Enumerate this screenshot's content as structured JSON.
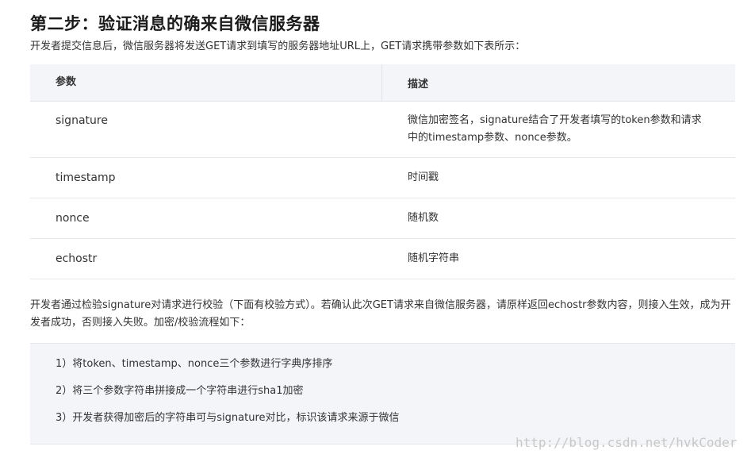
{
  "heading": "第二步：验证消息的确来自微信服务器",
  "intro": "开发者提交信息后，微信服务器将发送GET请求到填写的服务器地址URL上，GET请求携带参数如下表所示：",
  "table": {
    "headers": [
      "参数",
      "描述"
    ],
    "rows": [
      {
        "param": "signature",
        "desc": "微信加密签名，signature结合了开发者填写的token参数和请求中的timestamp参数、nonce参数。"
      },
      {
        "param": "timestamp",
        "desc": "时间戳"
      },
      {
        "param": "nonce",
        "desc": "随机数"
      },
      {
        "param": "echostr",
        "desc": "随机字符串"
      }
    ]
  },
  "paragraph": "开发者通过检验signature对请求进行校验（下面有校验方式）。若确认此次GET请求来自微信服务器，请原样返回echostr参数内容，则接入生效，成为开发者成功，否则接入失败。加密/校验流程如下：",
  "steps": [
    "1）将token、timestamp、nonce三个参数进行字典序排序",
    "2）将三个参数字符串拼接成一个字符串进行sha1加密",
    "3）开发者获得加密后的字符串可与signature对比，标识该请求来源于微信"
  ],
  "watermark": "http://blog.csdn.net/hvkCoder"
}
